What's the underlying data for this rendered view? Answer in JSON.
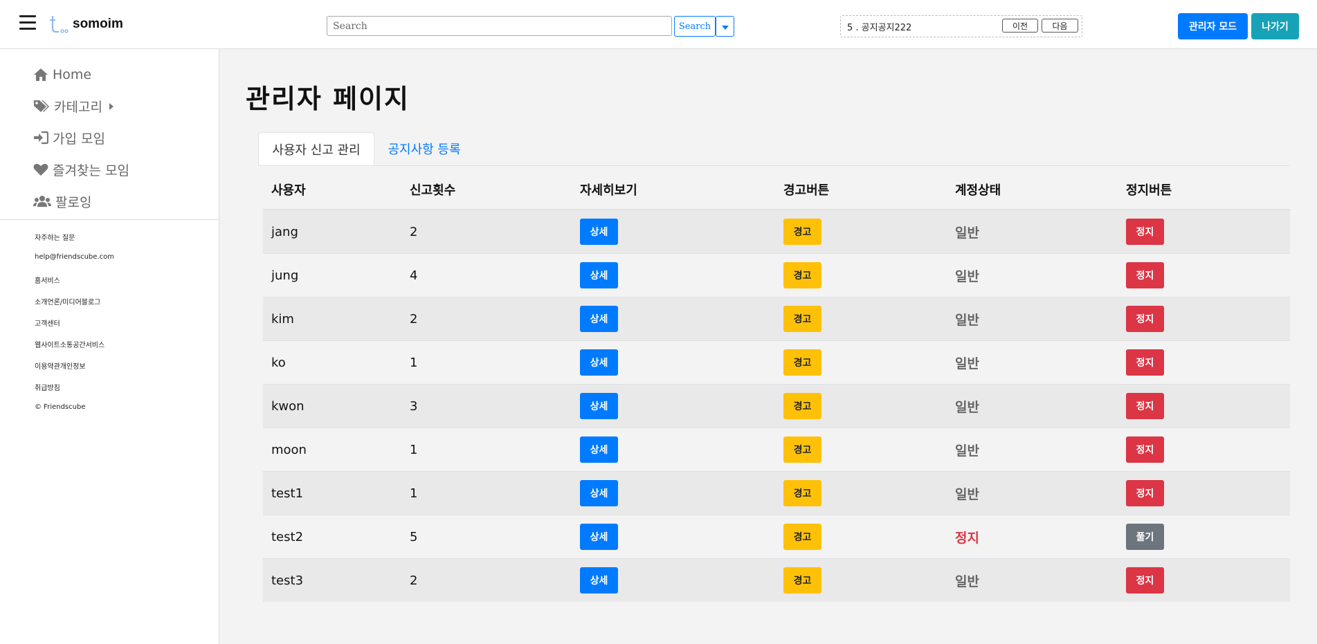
{
  "header": {
    "logo_text": "somoim",
    "search": {
      "placeholder": "Search",
      "value": "",
      "button_label": "Search"
    },
    "notice": {
      "text": "5 . 공지공지222",
      "prev_label": "이전",
      "next_label": "다음"
    },
    "admin_mode_label": "관리자 모드",
    "exit_label": "나가기"
  },
  "sidebar": {
    "items": [
      {
        "label": "Home",
        "icon": "home-icon"
      },
      {
        "label": "카테고리",
        "icon": "tags-icon"
      },
      {
        "label": "가입 모임",
        "icon": "sign-in-icon"
      },
      {
        "label": "즐겨찾는 모임",
        "icon": "heart-icon"
      },
      {
        "label": "팔로잉",
        "icon": "users-icon"
      }
    ],
    "footer_links": [
      "자주하는 질문",
      "help@friendscube.com",
      "홈서비스",
      "소개언론/미디어블로그",
      "고객센터",
      "웹사이트소통공간서비스",
      "이용약관개인정보",
      "취급방침",
      "© Friendscube"
    ]
  },
  "main": {
    "title": "관리자 페이지",
    "tabs": [
      {
        "label": "사용자 신고 관리"
      },
      {
        "label": "공지사항 등록"
      }
    ],
    "table": {
      "headers": [
        "사용자",
        "신고횟수",
        "자세히보기",
        "경고버튼",
        "계정상태",
        "정지버튼"
      ],
      "rows": [
        {
          "user": "jang",
          "count": "2",
          "detail": "상세",
          "warn": "경고",
          "status": "일반",
          "action": "정지"
        },
        {
          "user": "jung",
          "count": "4",
          "detail": "상세",
          "warn": "경고",
          "status": "일반",
          "action": "정지"
        },
        {
          "user": "kim",
          "count": "2",
          "detail": "상세",
          "warn": "경고",
          "status": "일반",
          "action": "정지"
        },
        {
          "user": "ko",
          "count": "1",
          "detail": "상세",
          "warn": "경고",
          "status": "일반",
          "action": "정지"
        },
        {
          "user": "kwon",
          "count": "3",
          "detail": "상세",
          "warn": "경고",
          "status": "일반",
          "action": "정지"
        },
        {
          "user": "moon",
          "count": "1",
          "detail": "상세",
          "warn": "경고",
          "status": "일반",
          "action": "정지"
        },
        {
          "user": "test1",
          "count": "1",
          "detail": "상세",
          "warn": "경고",
          "status": "일반",
          "action": "정지"
        },
        {
          "user": "test2",
          "count": "5",
          "detail": "상세",
          "warn": "경고",
          "status": "정지",
          "action": "풀기"
        },
        {
          "user": "test3",
          "count": "2",
          "detail": "상세",
          "warn": "경고",
          "status": "일반",
          "action": "정지"
        }
      ]
    }
  },
  "colors": {
    "primary": "#007bff",
    "info": "#17a2b8",
    "warning": "#ffc107",
    "danger": "#dc3545",
    "secondary": "#6c757d"
  }
}
